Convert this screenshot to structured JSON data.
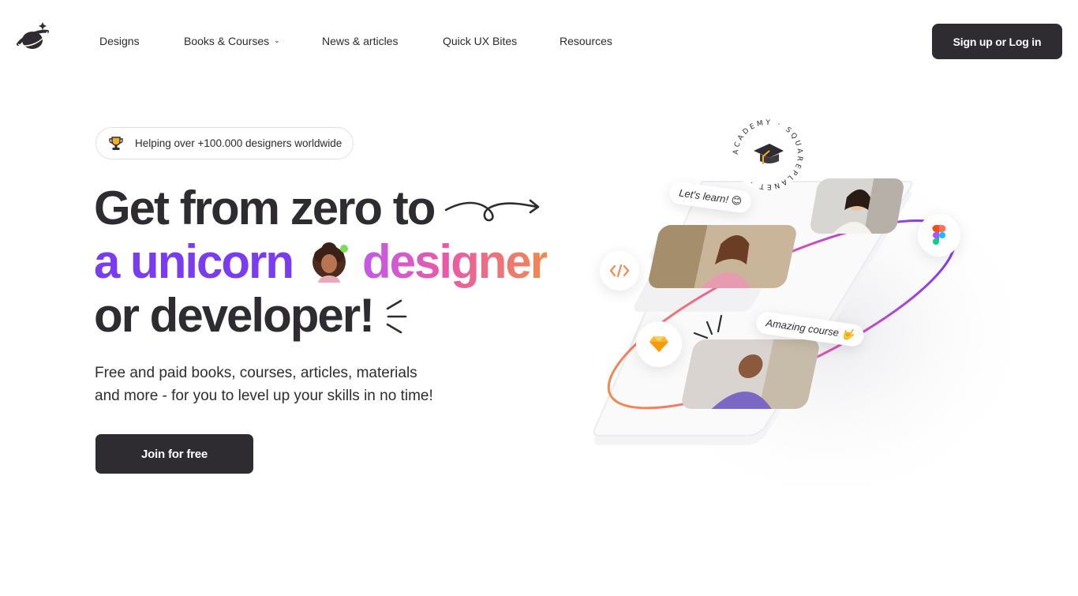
{
  "nav": {
    "logo_icon": "planet-logo-icon",
    "items": [
      {
        "label": "Designs"
      },
      {
        "label": "Books & Courses",
        "has_dropdown": true
      },
      {
        "label": "News & articles"
      },
      {
        "label": "Quick UX Bites"
      },
      {
        "label": "Resources"
      }
    ],
    "cta_label": "Sign up or Log in"
  },
  "hero": {
    "badge_icon": "trophy-icon",
    "badge_text": "Helping over +100.000 designers worldwide",
    "headline_line1": "Get from zero to",
    "headline_line2_a": "a unicorn",
    "headline_line2_b": "designer",
    "headline_line3": "or developer!",
    "description_line1": "Free and paid books, courses, articles, materials",
    "description_line2": "and more - for you to level up your skills in no time!",
    "cta_label": "Join for free"
  },
  "illustration": {
    "bubble_1": "Let's learn!",
    "bubble_2": "Amazing course",
    "seal_text": "ACADEMY · SQUAREPLANET ·",
    "icons": [
      "code-icon",
      "sketch-icon",
      "figma-icon",
      "graduation-cap-icon"
    ]
  },
  "colors": {
    "dark": "#2e2c31",
    "purple": "#7a3cf0",
    "pink": "#e85aa8",
    "orange": "#f08a50"
  }
}
